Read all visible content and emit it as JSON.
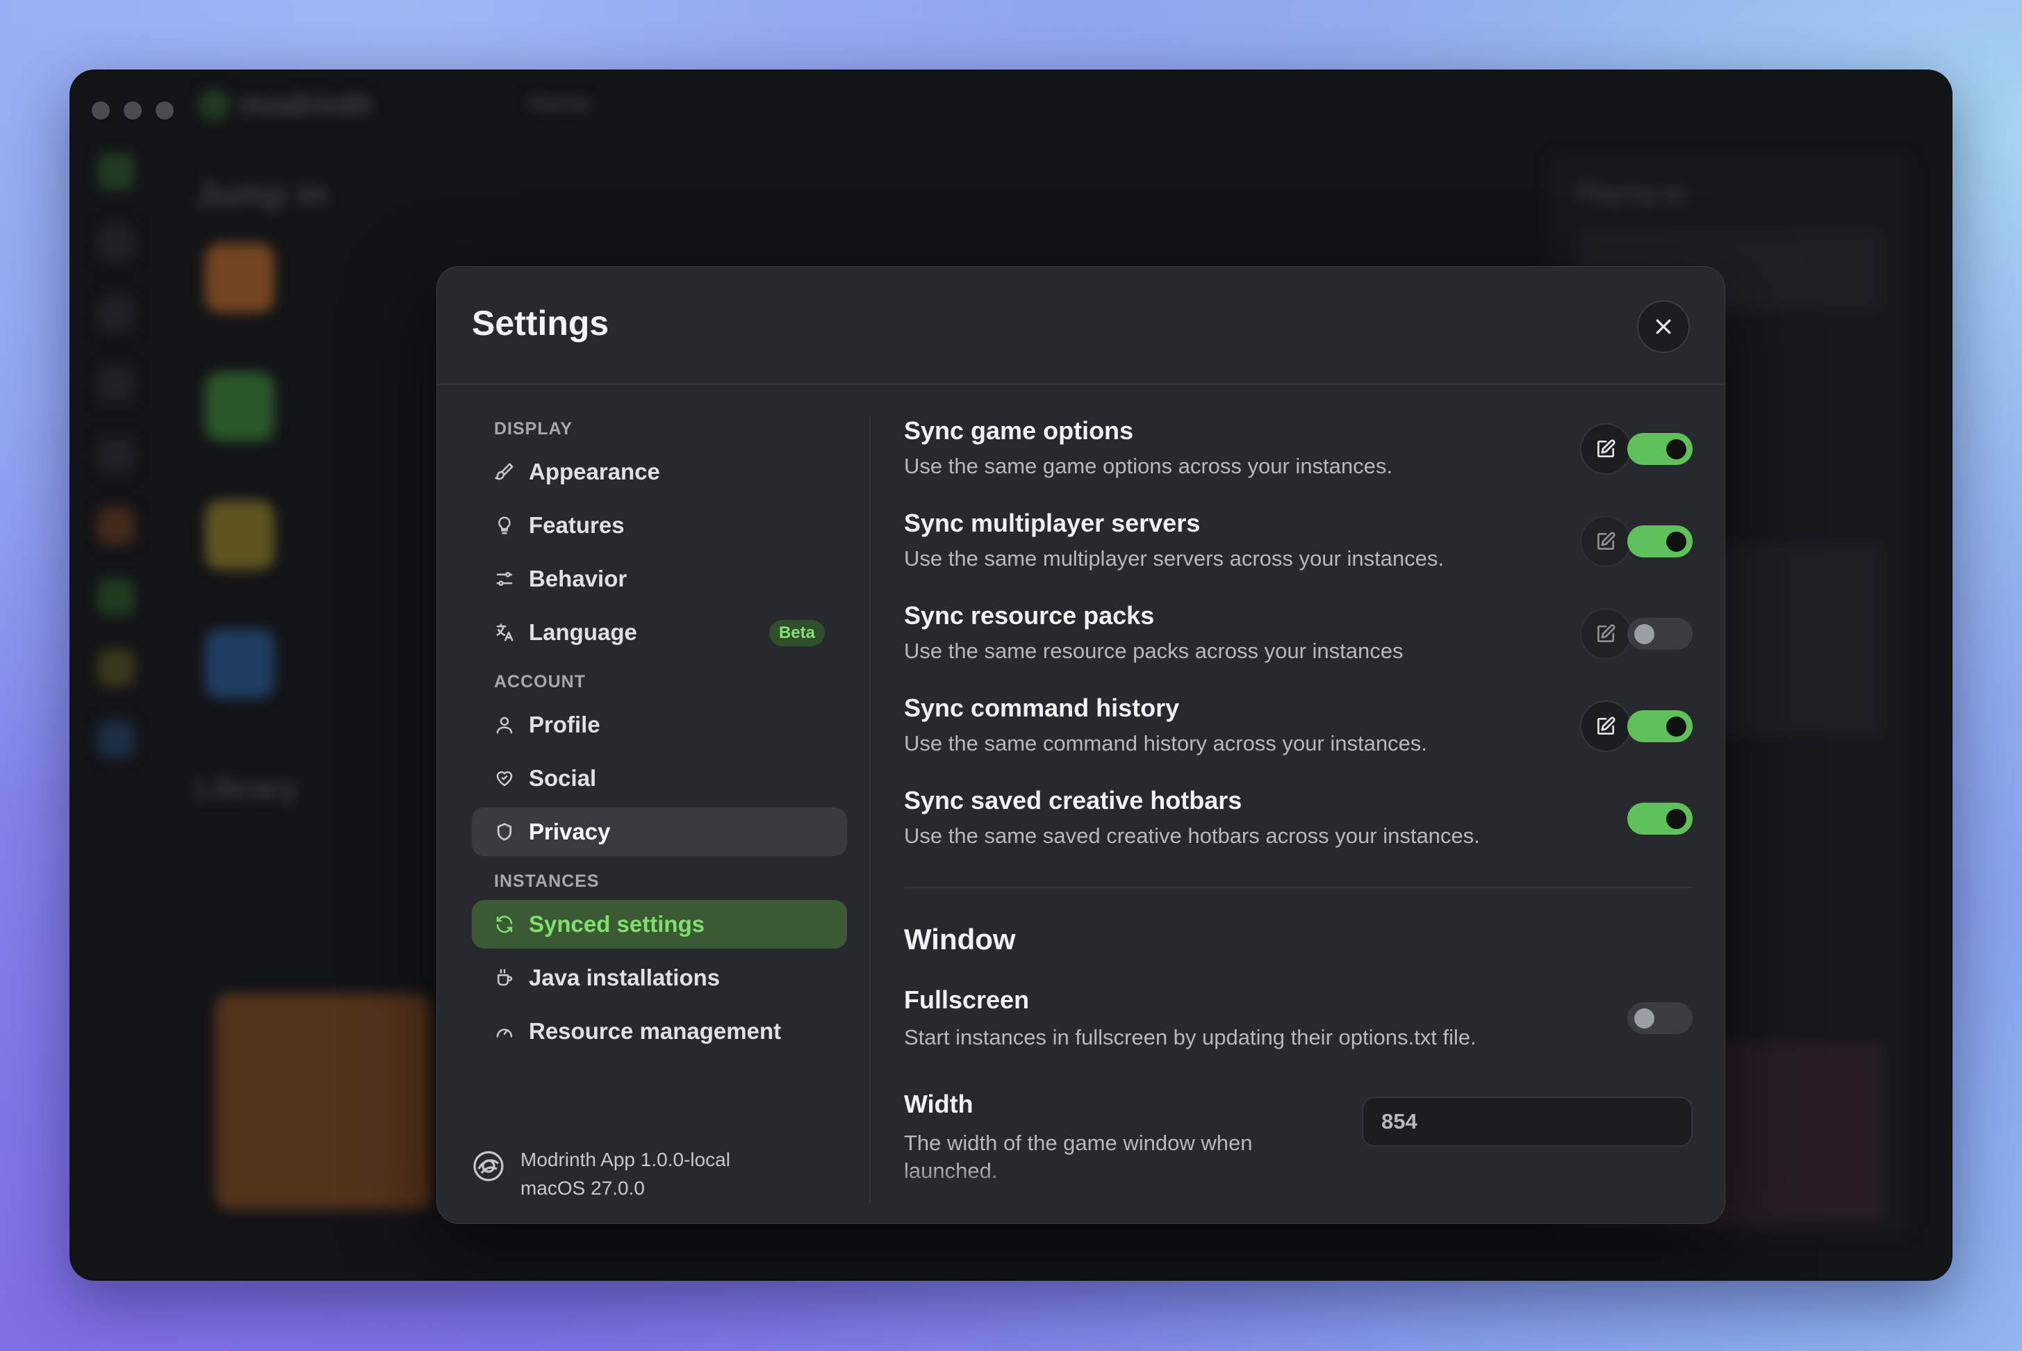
{
  "background_app": {
    "logo": "modrinth",
    "tab": "Home",
    "heading": "Jump in",
    "library": "Library",
    "right_panel_title": "Playing as"
  },
  "modal": {
    "title": "Settings",
    "close_icon": "close-icon"
  },
  "sidebar": {
    "sections": [
      {
        "label": "DISPLAY",
        "items": [
          {
            "label": "Appearance",
            "icon": "paintbrush-icon"
          },
          {
            "label": "Features",
            "icon": "lightbulb-icon"
          },
          {
            "label": "Behavior",
            "icon": "sliders-icon"
          },
          {
            "label": "Language",
            "icon": "language-icon",
            "badge": "Beta"
          }
        ]
      },
      {
        "label": "ACCOUNT",
        "items": [
          {
            "label": "Profile",
            "icon": "user-icon"
          },
          {
            "label": "Social",
            "icon": "heart-handshake-icon"
          },
          {
            "label": "Privacy",
            "icon": "shield-icon"
          }
        ]
      },
      {
        "label": "INSTANCES",
        "items": [
          {
            "label": "Synced settings",
            "icon": "sync-icon"
          },
          {
            "label": "Java installations",
            "icon": "coffee-icon"
          },
          {
            "label": "Resource management",
            "icon": "gauge-icon"
          }
        ]
      }
    ],
    "footer": {
      "app_version": "Modrinth App 1.0.0-local",
      "os_version": "macOS 27.0.0"
    }
  },
  "content": {
    "sync_options": [
      {
        "title": "Sync game options",
        "description": "Use the same game options across your instances.",
        "enabled": true,
        "editable": true
      },
      {
        "title": "Sync multiplayer servers",
        "description": "Use the same multiplayer servers across your instances.",
        "enabled": true,
        "editable": true
      },
      {
        "title": "Sync resource packs",
        "description": "Use the same resource packs across your instances",
        "enabled": false,
        "editable": true
      },
      {
        "title": "Sync command history",
        "description": "Use the same command history across your instances.",
        "enabled": true,
        "editable": true
      },
      {
        "title": "Sync saved creative hotbars",
        "description": "Use the same saved creative hotbars across your instances.",
        "enabled": true,
        "editable": false
      }
    ],
    "window": {
      "heading": "Window",
      "fullscreen": {
        "title": "Fullscreen",
        "description": "Start instances in fullscreen by updating their options.txt file.",
        "enabled": false
      },
      "width": {
        "title": "Width",
        "description_line1": "The width of the game window when",
        "description_line2": "launched.",
        "value": "854"
      }
    }
  },
  "colors": {
    "accent_green": "#5fc15a",
    "active_nav_bg": "#3b5a34",
    "modal_bg": "#27292e"
  }
}
